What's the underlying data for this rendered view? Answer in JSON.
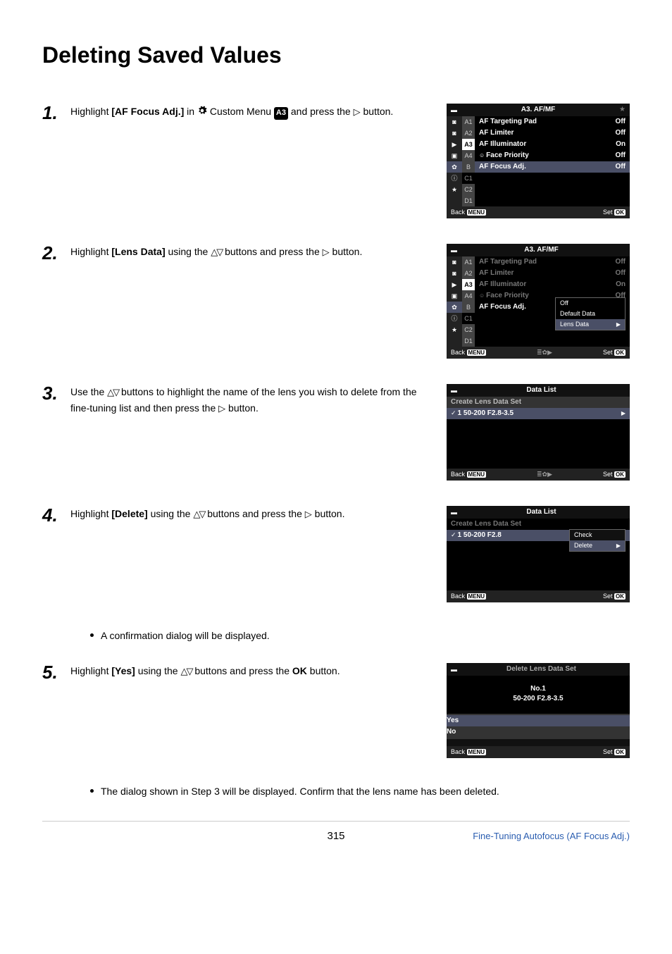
{
  "title": "Deleting Saved Values",
  "pageNumber": "315",
  "footerLink": "Fine-Tuning Autofocus (AF Focus Adj.)",
  "steps": {
    "s1": {
      "num": "1.",
      "t1": "Highlight ",
      "b1": "[AF Focus Adj.]",
      "t2": " in ",
      "t3": " Custom Menu ",
      "badge": "A3",
      "t4": " and press the ",
      "t5": " button."
    },
    "s2": {
      "num": "2.",
      "t1": "Highlight ",
      "b1": "[Lens Data]",
      "t2": " using the ",
      "t3": " buttons and press the ",
      "t4": " button."
    },
    "s3": {
      "num": "3.",
      "t1": "Use the ",
      "t2": " buttons to highlight the name of the lens you wish to delete from the fine-tuning list and then press the ",
      "t3": " button."
    },
    "s4": {
      "num": "4.",
      "t1": "Highlight ",
      "b1": "[Delete]",
      "t2": " using the ",
      "t3": " buttons and press the ",
      "t4": " button."
    },
    "bullet1": "A confirmation dialog will be displayed.",
    "s5": {
      "num": "5.",
      "t1": "Highlight ",
      "b1": "[Yes]",
      "t2": " using the ",
      "t3": " buttons and press the ",
      "b2": "OK",
      "t4": " button."
    },
    "bullet2": "The dialog shown in Step 3 will be displayed. Confirm that the lens name has been deleted."
  },
  "screens": {
    "s1": {
      "title": "A3. AF/MF",
      "side": [
        "A1",
        "A2",
        "A3",
        "A4",
        "B",
        "C1",
        "C2",
        "D1"
      ],
      "items": [
        {
          "lbl": "AF Targeting Pad",
          "val": "Off"
        },
        {
          "lbl": "AF Limiter",
          "val": "Off"
        },
        {
          "lbl": "AF Illuminator",
          "val": "On"
        },
        {
          "lbl": "Face Priority",
          "val": "Off",
          "face": true
        },
        {
          "lbl": "AF Focus Adj.",
          "val": "Off",
          "hl": true
        }
      ],
      "back": "Back",
      "backBtn": "MENU",
      "set": "Set",
      "setBtn": "OK"
    },
    "s2": {
      "title": "A3. AF/MF",
      "popup": [
        "Off",
        "Default Data",
        "Lens Data"
      ],
      "back": "Back",
      "set": "Set"
    },
    "s3": {
      "title": "Data List",
      "create": "Create Lens Data Set",
      "lens": "1  50-200 F2.8-3.5",
      "back": "Back",
      "set": "Set"
    },
    "s4": {
      "title": "Data List",
      "create": "Create Lens Data Set",
      "lens": "1  50-200 F2.8",
      "popup": [
        "Check",
        "Delete"
      ],
      "back": "Back",
      "set": "Set"
    },
    "s5": {
      "title": "Delete Lens Data Set",
      "no": "No.1",
      "lens": "50-200 F2.8-3.5",
      "yes": "Yes",
      "noLbl": "No",
      "back": "Back",
      "set": "Set"
    }
  }
}
